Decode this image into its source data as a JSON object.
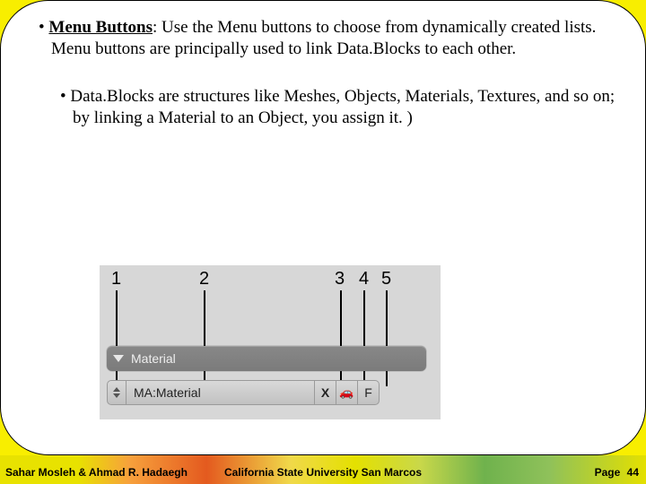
{
  "bullets": {
    "level1": {
      "label": "Menu Buttons",
      "text": ": Use the Menu buttons to choose from dynamically created lists. Menu buttons are principally used to link Data.Blocks to each other."
    },
    "level2": {
      "text": "Data.Blocks are structures like Meshes, Objects, Materials, Textures, and so on; by linking a Material to an Object, you assign it. )"
    }
  },
  "figure": {
    "numbers": {
      "n1": "1",
      "n2": "2",
      "n3": "3",
      "n4": "4",
      "n5": "5"
    },
    "row1_label": "Material",
    "row2_name": "MA:Material",
    "row2_x": "X",
    "row2_car": "🚗",
    "row2_f": "F"
  },
  "footer": {
    "left": "Sahar Mosleh & Ahmad R. Hadaegh",
    "mid": "California State University San Marcos",
    "right_label": "Page",
    "right_num": "44"
  }
}
